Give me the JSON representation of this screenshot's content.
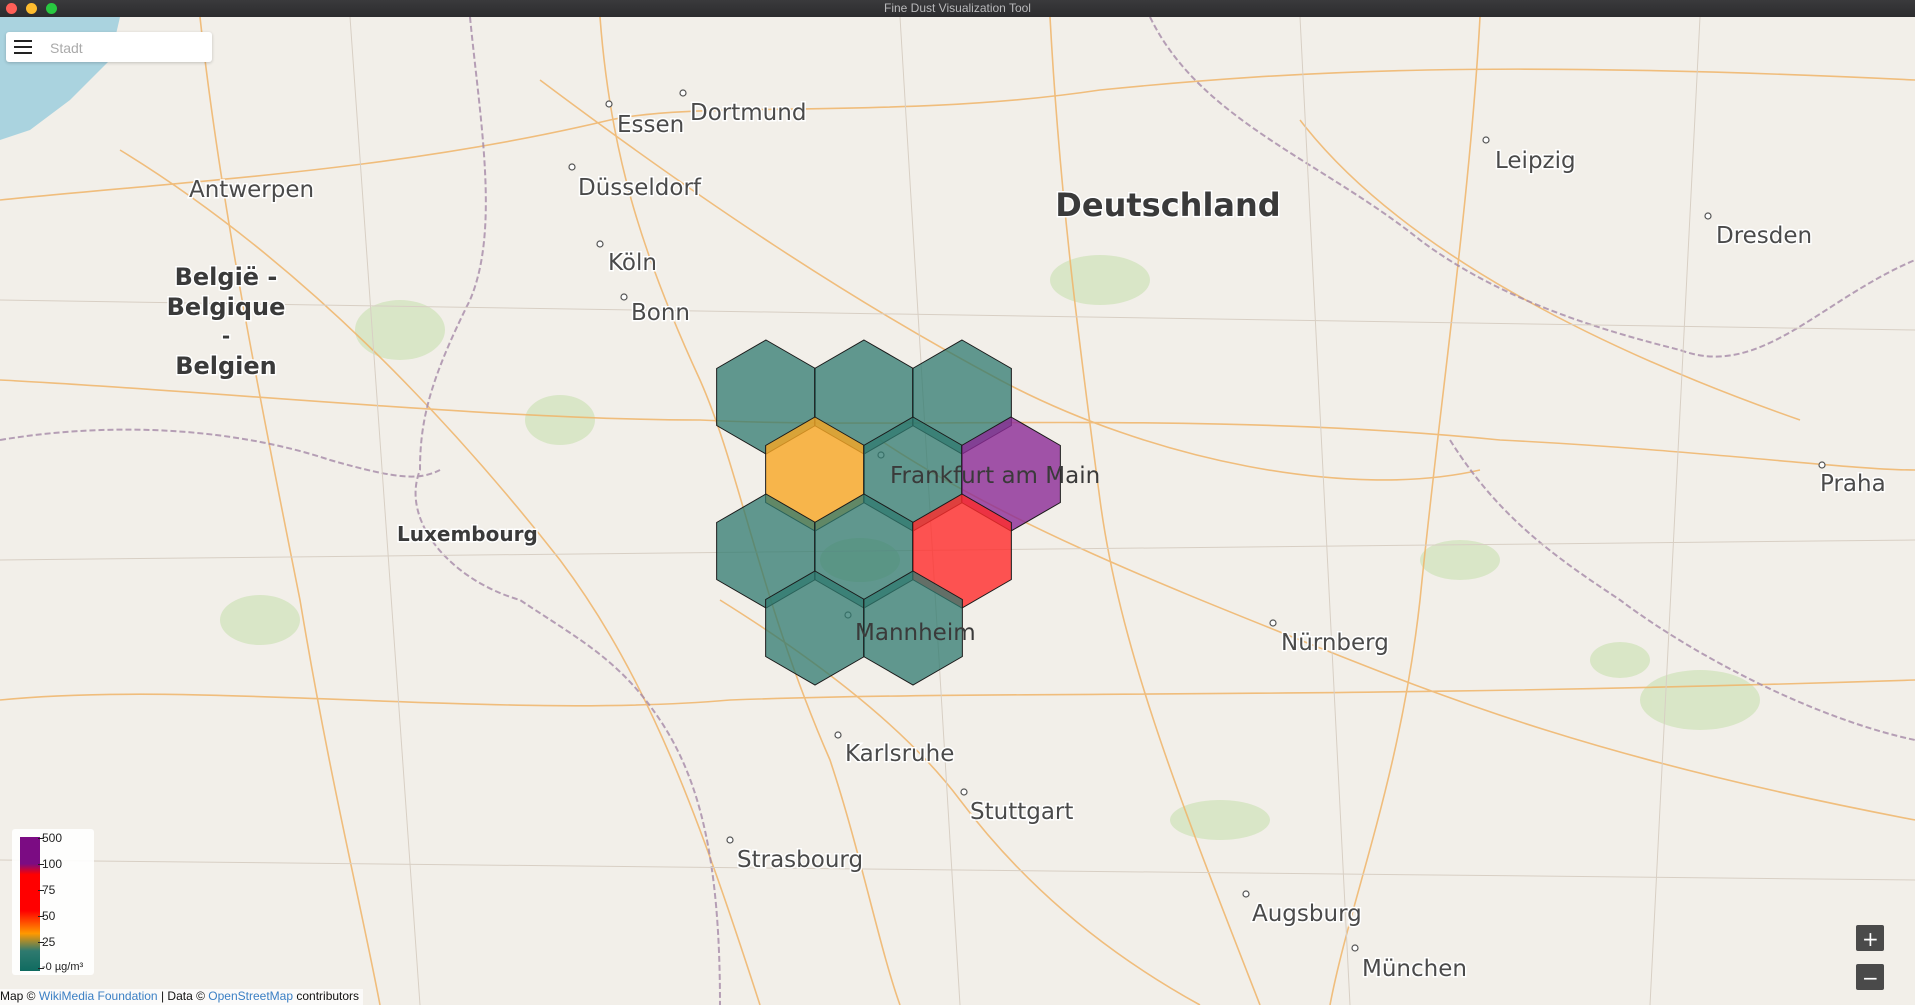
{
  "window": {
    "title": "Fine Dust Visualization Tool"
  },
  "search": {
    "placeholder": "Stadt",
    "value": ""
  },
  "map": {
    "cities": [
      "Essen",
      "Dortmund",
      "Düsseldorf",
      "Antwerpen",
      "Köln",
      "Bonn",
      "Leipzig",
      "Dresden",
      "Frankfurt am Main",
      "Mannheim",
      "Nürnberg",
      "Karlsruhe",
      "Stuttgart",
      "Strasbourg",
      "Augsburg",
      "München",
      "Praha",
      "Luxembourg"
    ],
    "countries": [
      "Deutschland",
      "België -",
      "Belgique",
      "-",
      "Belgien"
    ]
  },
  "legend": {
    "ticks": [
      "500",
      "100",
      "75",
      "50",
      "25",
      "-0 µg/m³"
    ],
    "colors": [
      "#7b0c83",
      "#7b0c83",
      "#ff0000",
      "#ff0000",
      "#ff9900",
      "#0f6b60"
    ]
  },
  "hexagons": [
    {
      "level": "low",
      "color": "#2f7a6f"
    },
    {
      "level": "low",
      "color": "#2f7a6f"
    },
    {
      "level": "low",
      "color": "#2f7a6f"
    },
    {
      "level": "moderate",
      "color": "#f7a623"
    },
    {
      "level": "low",
      "color": "#2f7a6f"
    },
    {
      "level": "very-high",
      "color": "#8b2a96"
    },
    {
      "level": "low",
      "color": "#2f7a6f"
    },
    {
      "level": "low",
      "color": "#2f7a6f"
    },
    {
      "level": "high",
      "color": "#ff2a2a"
    },
    {
      "level": "low",
      "color": "#2f7a6f"
    },
    {
      "level": "low",
      "color": "#2f7a6f"
    }
  ],
  "zoom": {
    "in_label": "+",
    "out_label": "−"
  },
  "attribution": {
    "prefix": "Map ©",
    "wiki": "WikiMedia Foundation",
    "middle": "| Data ©",
    "osm": "OpenStreetMap",
    "suffix": "contributors"
  }
}
